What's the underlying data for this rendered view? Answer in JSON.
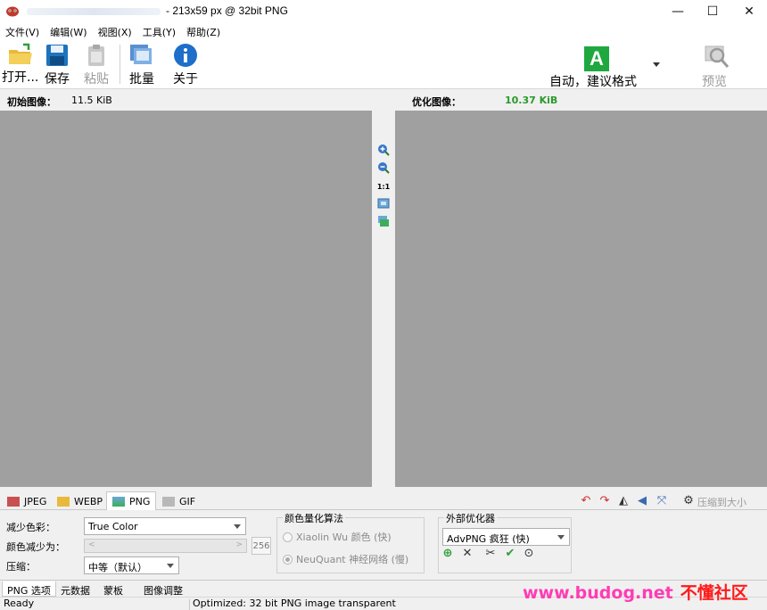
{
  "window": {
    "title": "- 213x59 px @ 32bit PNG",
    "minimize": "—",
    "maximize": "☐",
    "close": "✕"
  },
  "menu": [
    "文件(V)",
    "编辑(W)",
    "视图(X)",
    "工具(Y)",
    "帮助(Z)"
  ],
  "toolbar": {
    "open": "打开...",
    "save": "保存",
    "paste": "粘贴",
    "batch": "批量",
    "about": "关于",
    "auto_letter": "A",
    "auto": "自动，建议格式",
    "preview": "预览"
  },
  "info": {
    "original_label": "初始图像：",
    "original_size": "11.5 KiB",
    "optimized_label": "优化图像：",
    "optimized_size": "10.37 KiB",
    "optimized_color": "#2a9a2a"
  },
  "mid_tools": [
    "zoom-in-icon",
    "zoom-out-icon",
    "actual-size-icon",
    "fit-icon",
    "swap-icon"
  ],
  "mid_actual": "1:1",
  "format_tabs": [
    {
      "label": "JPEG",
      "icon": "jpeg-icon",
      "active": false
    },
    {
      "label": "WEBP",
      "icon": "webp-icon",
      "active": false
    },
    {
      "label": "PNG",
      "icon": "png-icon",
      "active": true
    },
    {
      "label": "GIF",
      "icon": "gif-icon",
      "active": false
    }
  ],
  "compress_to_size": "压缩到大小",
  "png_options": {
    "reduce_colors_label": "减少色彩：",
    "reduce_colors_value": "True Color",
    "reduce_to_label": "颜色减少为：",
    "reduce_to_value": "256",
    "compression_label": "压缩：",
    "compression_value": "中等（默认）"
  },
  "quantization": {
    "title": "颜色量化算法",
    "option1": "Xiaolin Wu 颜色 (快)",
    "option2": "NeuQuant 神经网络 (慢)"
  },
  "external": {
    "title": "外部优化器",
    "value": "AdvPNG 疯狂 (快)"
  },
  "bottom_tabs": [
    "PNG 选项",
    "元数据",
    "蒙板",
    "图像调整"
  ],
  "status": {
    "ready": "Ready",
    "message": "Optimized: 32 bit PNG image transparent"
  },
  "watermark": {
    "en": "www.budog.net",
    "cn": "不懂社区"
  }
}
